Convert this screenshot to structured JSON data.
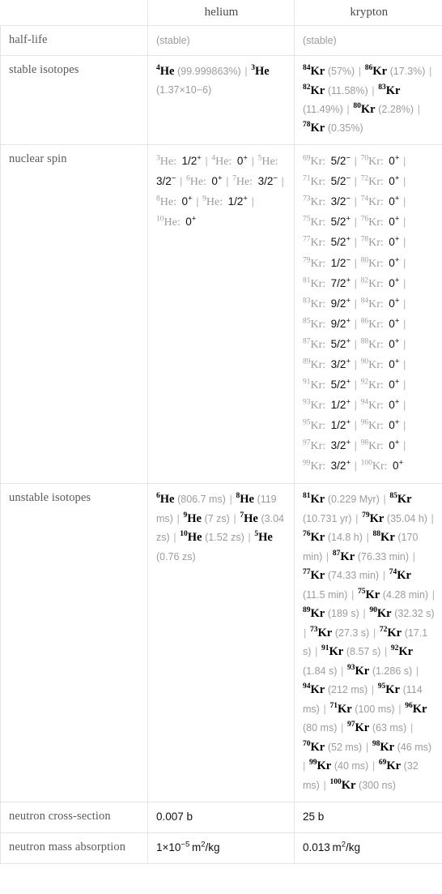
{
  "header": {
    "corner": "",
    "columns": [
      "helium",
      "krypton"
    ]
  },
  "rows": [
    {
      "label": "half-life"
    },
    {
      "label": "stable isotopes"
    },
    {
      "label": "nuclear spin"
    },
    {
      "label": "unstable isotopes"
    },
    {
      "label": "neutron cross-section"
    },
    {
      "label": "neutron mass absorption"
    }
  ],
  "half_life": {
    "helium": "(stable)",
    "krypton": "(stable)"
  },
  "stable_isotopes": {
    "helium": [
      {
        "mass": "4",
        "element": "He",
        "abundance": "(99.999863%)"
      },
      {
        "mass": "3",
        "element": "He",
        "abundance": "(1.37×10−6)"
      }
    ],
    "krypton": [
      {
        "mass": "84",
        "element": "Kr",
        "abundance": "(57%)"
      },
      {
        "mass": "86",
        "element": "Kr",
        "abundance": "(17.3%)"
      },
      {
        "mass": "82",
        "element": "Kr",
        "abundance": "(11.58%)"
      },
      {
        "mass": "83",
        "element": "Kr",
        "abundance": "(11.49%)"
      },
      {
        "mass": "80",
        "element": "Kr",
        "abundance": "(2.28%)"
      },
      {
        "mass": "78",
        "element": "Kr",
        "abundance": "(0.35%)"
      }
    ]
  },
  "nuclear_spin": {
    "helium": [
      {
        "mass": "3",
        "element": "He",
        "spin": "1/2",
        "sign": "+"
      },
      {
        "mass": "4",
        "element": "He",
        "spin": "0",
        "sign": "+"
      },
      {
        "mass": "5",
        "element": "He",
        "spin": "3/2",
        "sign": "−"
      },
      {
        "mass": "6",
        "element": "He",
        "spin": "0",
        "sign": "+"
      },
      {
        "mass": "7",
        "element": "He",
        "spin": "3/2",
        "sign": "−"
      },
      {
        "mass": "8",
        "element": "He",
        "spin": "0",
        "sign": "+"
      },
      {
        "mass": "9",
        "element": "He",
        "spin": "1/2",
        "sign": "+"
      },
      {
        "mass": "10",
        "element": "He",
        "spin": "0",
        "sign": "+"
      }
    ],
    "krypton": [
      {
        "mass": "69",
        "element": "Kr",
        "spin": "5/2",
        "sign": "−"
      },
      {
        "mass": "70",
        "element": "Kr",
        "spin": "0",
        "sign": "+"
      },
      {
        "mass": "71",
        "element": "Kr",
        "spin": "5/2",
        "sign": "−"
      },
      {
        "mass": "72",
        "element": "Kr",
        "spin": "0",
        "sign": "+"
      },
      {
        "mass": "73",
        "element": "Kr",
        "spin": "3/2",
        "sign": "−"
      },
      {
        "mass": "74",
        "element": "Kr",
        "spin": "0",
        "sign": "+"
      },
      {
        "mass": "75",
        "element": "Kr",
        "spin": "5/2",
        "sign": "+"
      },
      {
        "mass": "76",
        "element": "Kr",
        "spin": "0",
        "sign": "+"
      },
      {
        "mass": "77",
        "element": "Kr",
        "spin": "5/2",
        "sign": "+"
      },
      {
        "mass": "78",
        "element": "Kr",
        "spin": "0",
        "sign": "+"
      },
      {
        "mass": "79",
        "element": "Kr",
        "spin": "1/2",
        "sign": "−"
      },
      {
        "mass": "80",
        "element": "Kr",
        "spin": "0",
        "sign": "+"
      },
      {
        "mass": "81",
        "element": "Kr",
        "spin": "7/2",
        "sign": "+"
      },
      {
        "mass": "82",
        "element": "Kr",
        "spin": "0",
        "sign": "+"
      },
      {
        "mass": "83",
        "element": "Kr",
        "spin": "9/2",
        "sign": "+"
      },
      {
        "mass": "84",
        "element": "Kr",
        "spin": "0",
        "sign": "+"
      },
      {
        "mass": "85",
        "element": "Kr",
        "spin": "9/2",
        "sign": "+"
      },
      {
        "mass": "86",
        "element": "Kr",
        "spin": "0",
        "sign": "+"
      },
      {
        "mass": "87",
        "element": "Kr",
        "spin": "5/2",
        "sign": "+"
      },
      {
        "mass": "88",
        "element": "Kr",
        "spin": "0",
        "sign": "+"
      },
      {
        "mass": "89",
        "element": "Kr",
        "spin": "3/2",
        "sign": "+"
      },
      {
        "mass": "90",
        "element": "Kr",
        "spin": "0",
        "sign": "+"
      },
      {
        "mass": "91",
        "element": "Kr",
        "spin": "5/2",
        "sign": "+"
      },
      {
        "mass": "92",
        "element": "Kr",
        "spin": "0",
        "sign": "+"
      },
      {
        "mass": "93",
        "element": "Kr",
        "spin": "1/2",
        "sign": "+"
      },
      {
        "mass": "94",
        "element": "Kr",
        "spin": "0",
        "sign": "+"
      },
      {
        "mass": "95",
        "element": "Kr",
        "spin": "1/2",
        "sign": "+"
      },
      {
        "mass": "96",
        "element": "Kr",
        "spin": "0",
        "sign": "+"
      },
      {
        "mass": "97",
        "element": "Kr",
        "spin": "3/2",
        "sign": "+"
      },
      {
        "mass": "98",
        "element": "Kr",
        "spin": "0",
        "sign": "+"
      },
      {
        "mass": "99",
        "element": "Kr",
        "spin": "3/2",
        "sign": "+"
      },
      {
        "mass": "100",
        "element": "Kr",
        "spin": "0",
        "sign": "+"
      }
    ]
  },
  "unstable_isotopes": {
    "helium": [
      {
        "mass": "6",
        "element": "He",
        "halflife": "(806.7 ms)"
      },
      {
        "mass": "8",
        "element": "He",
        "halflife": "(119 ms)"
      },
      {
        "mass": "9",
        "element": "He",
        "halflife": "(7 zs)"
      },
      {
        "mass": "7",
        "element": "He",
        "halflife": "(3.04 zs)"
      },
      {
        "mass": "10",
        "element": "He",
        "halflife": "(1.52 zs)"
      },
      {
        "mass": "5",
        "element": "He",
        "halflife": "(0.76 zs)"
      }
    ],
    "krypton": [
      {
        "mass": "81",
        "element": "Kr",
        "halflife": "(0.229 Myr)"
      },
      {
        "mass": "85",
        "element": "Kr",
        "halflife": "(10.731 yr)"
      },
      {
        "mass": "79",
        "element": "Kr",
        "halflife": "(35.04 h)"
      },
      {
        "mass": "76",
        "element": "Kr",
        "halflife": "(14.8 h)"
      },
      {
        "mass": "88",
        "element": "Kr",
        "halflife": "(170 min)"
      },
      {
        "mass": "87",
        "element": "Kr",
        "halflife": "(76.33 min)"
      },
      {
        "mass": "77",
        "element": "Kr",
        "halflife": "(74.33 min)"
      },
      {
        "mass": "74",
        "element": "Kr",
        "halflife": "(11.5 min)"
      },
      {
        "mass": "75",
        "element": "Kr",
        "halflife": "(4.28 min)"
      },
      {
        "mass": "89",
        "element": "Kr",
        "halflife": "(189 s)"
      },
      {
        "mass": "90",
        "element": "Kr",
        "halflife": "(32.32 s)"
      },
      {
        "mass": "73",
        "element": "Kr",
        "halflife": "(27.3 s)"
      },
      {
        "mass": "72",
        "element": "Kr",
        "halflife": "(17.1 s)"
      },
      {
        "mass": "91",
        "element": "Kr",
        "halflife": "(8.57 s)"
      },
      {
        "mass": "92",
        "element": "Kr",
        "halflife": "(1.84 s)"
      },
      {
        "mass": "93",
        "element": "Kr",
        "halflife": "(1.286 s)"
      },
      {
        "mass": "94",
        "element": "Kr",
        "halflife": "(212 ms)"
      },
      {
        "mass": "95",
        "element": "Kr",
        "halflife": "(114 ms)"
      },
      {
        "mass": "71",
        "element": "Kr",
        "halflife": "(100 ms)"
      },
      {
        "mass": "96",
        "element": "Kr",
        "halflife": "(80 ms)"
      },
      {
        "mass": "97",
        "element": "Kr",
        "halflife": "(63 ms)"
      },
      {
        "mass": "70",
        "element": "Kr",
        "halflife": "(52 ms)"
      },
      {
        "mass": "98",
        "element": "Kr",
        "halflife": "(46 ms)"
      },
      {
        "mass": "99",
        "element": "Kr",
        "halflife": "(40 ms)"
      },
      {
        "mass": "69",
        "element": "Kr",
        "halflife": "(32 ms)"
      },
      {
        "mass": "100",
        "element": "Kr",
        "halflife": "(300 ns)"
      }
    ]
  },
  "neutron_cross_section": {
    "helium": "0.007 b",
    "krypton": "25 b"
  },
  "neutron_mass_absorption": {
    "helium": {
      "mantissa": "1×10",
      "exponent": "−5",
      "unit": "m2/kg"
    },
    "krypton": {
      "value": "0.013",
      "unit": "m2/kg"
    }
  },
  "separator": "|"
}
